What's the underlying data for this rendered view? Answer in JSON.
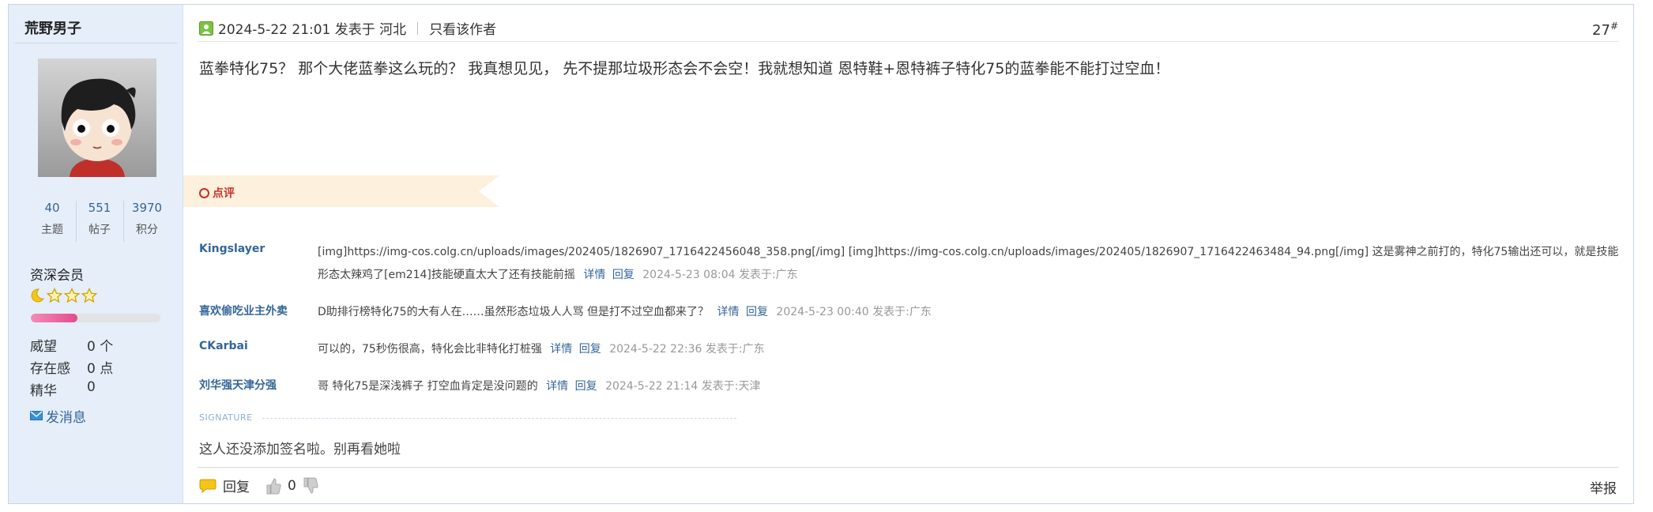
{
  "author": {
    "name": "荒野男子",
    "stats": [
      {
        "value": "40",
        "label": "主题"
      },
      {
        "value": "551",
        "label": "帖子"
      },
      {
        "value": "3970",
        "label": "积分"
      }
    ],
    "rank": "资深会员",
    "exp_progress": 0.36,
    "prestige_label": "威望",
    "prestige_value": "0 个",
    "presence_label": "存在感",
    "presence_value": "0 点",
    "essence_label": "精华",
    "essence_value": "0",
    "send_message": "发消息"
  },
  "post": {
    "posted_text": "2024-5-22 21:01 发表于 河北",
    "only_author": "只看该作者",
    "floor": "27",
    "floor_sup": "#",
    "message": "蓝拳特化75？ 那个大佬蓝拳这么玩的？ 我真想见见， 先不提那垃圾形态会不会空！我就想知道 恩特鞋+恩特裤子特化75的蓝拳能不能打过空血！"
  },
  "comments_section": {
    "label": "点评",
    "detail_label": "详情",
    "reply_label": "回复",
    "items": [
      {
        "user": "Kingslayer",
        "text": "[img]https://img-cos.colg.cn/uploads/images/202405/1826907_1716422456048_358.png[/img] [img]https://img-cos.colg.cn/uploads/images/202405/1826907_1716422463484_94.png[/img] 这是雾神之前打的，特化75输出还可以，就是技能形态太辣鸡了[em214]技能硬直太大了还有技能前摇",
        "meta": "2024-5-23 08:04 发表于:广东"
      },
      {
        "user": "喜欢偷吃业主外卖",
        "text": "D助排行榜特化75的大有人在……虽然形态垃圾人人骂 但是打不过空血都来了？",
        "meta": "2024-5-23 00:40 发表于:广东"
      },
      {
        "user": "CKarbai",
        "text": "可以的，75秒伤很高，特化会比非特化打桩强",
        "meta": "2024-5-22 22:36 发表于:广东"
      },
      {
        "user": "刘华强天津分强",
        "text": "哥 特化75是深浅裤子 打空血肯定是没问题的",
        "meta": "2024-5-22 21:14 发表于:天津"
      }
    ]
  },
  "signature": {
    "label": "SIGNATURE",
    "text": "这人还没添加签名啦。别再看她啦"
  },
  "actions": {
    "reply": "回复",
    "like_count": "0",
    "report": "举报"
  },
  "colors": {
    "author_bg": "#e5eef9",
    "link": "#336699",
    "comment_tag_bg": "#fdf0dc",
    "comment_accent": "#c9302c"
  }
}
